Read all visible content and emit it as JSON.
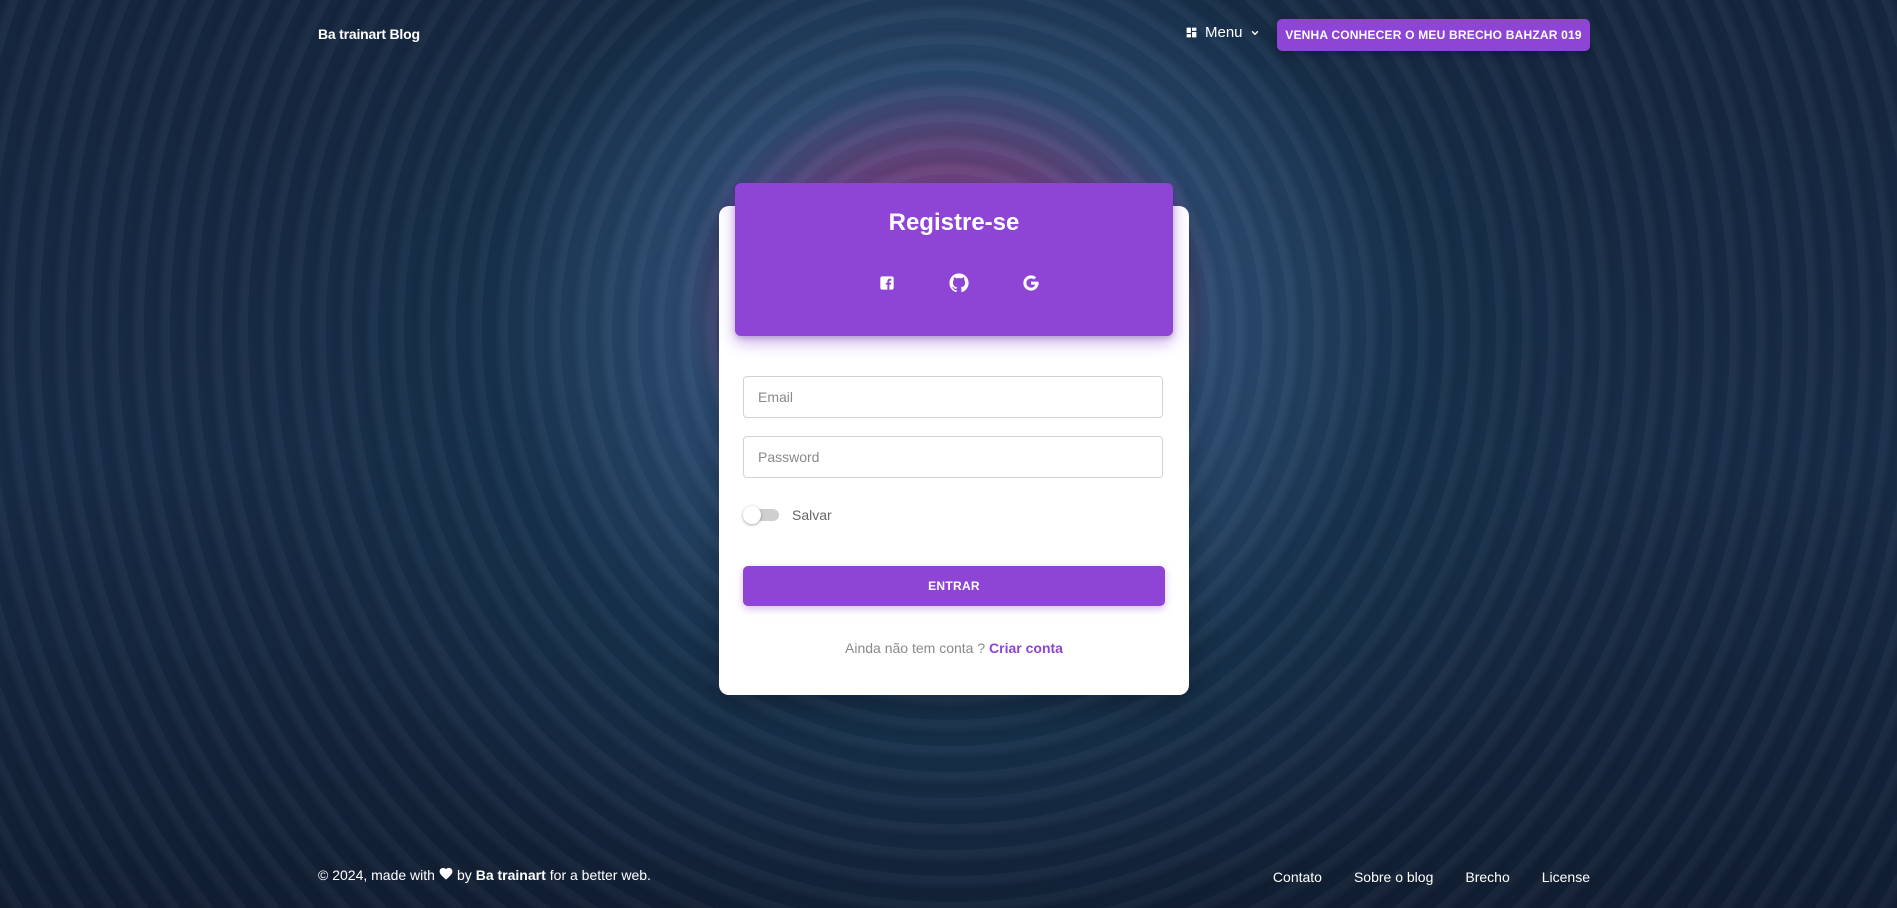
{
  "navbar": {
    "brand": "Ba trainart Blog",
    "menu_label": "Menu",
    "menu_icon": "dashboard-icon",
    "cta_label": "VENHA CONHECER O MEU BRECHO BAHZAR 019"
  },
  "card": {
    "title": "Registre-se",
    "social_icons": [
      "facebook-icon",
      "github-icon",
      "google-icon"
    ],
    "email_placeholder": "Email",
    "password_placeholder": "Password",
    "remember_label": "Salvar",
    "submit_label": "ENTRAR",
    "signup_prompt": "Ainda não tem conta ?",
    "signup_link": "Criar conta"
  },
  "footer": {
    "copyright": "© 2024, made with",
    "by": "by",
    "author": "Ba trainart",
    "suffix": "for a better web.",
    "links": [
      "Contato",
      "Sobre o blog",
      "Brecho",
      "License"
    ]
  },
  "colors": {
    "accent": "#8e44d4"
  }
}
